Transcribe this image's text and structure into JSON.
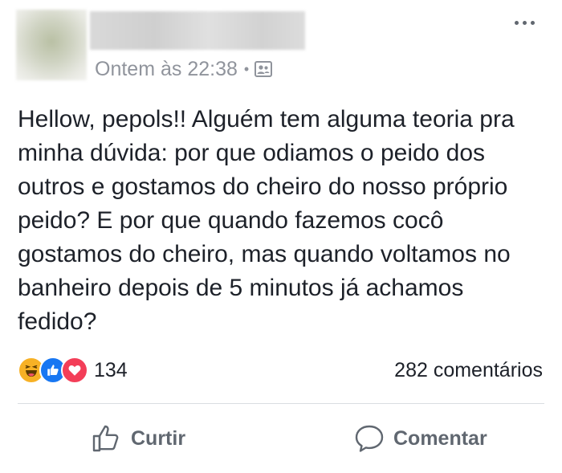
{
  "post": {
    "timestamp": "Ontem às 22:38",
    "separator": "•",
    "audience_icon": "friends-icon",
    "text": "Hellow, pepols!! Alguém tem alguma teoria pra minha dúvida: por que odiamos o peido dos outros e gostamos do cheiro do nosso próprio peido? E por que quando fazemos cocô gostamos do cheiro, mas quando voltamos no banheiro depois de 5 minutos já achamos fedido?"
  },
  "reactions": {
    "types": [
      "haha",
      "like",
      "love"
    ],
    "count": "134"
  },
  "comments": {
    "count_label": "282 comentários"
  },
  "actions": {
    "like_label": "Curtir",
    "comment_label": "Comentar"
  },
  "colors": {
    "like_blue": "#1877f2",
    "love_red": "#f33e58",
    "haha_yellow": "#f7b125",
    "muted_text": "#90949c",
    "action_text": "#606770"
  }
}
